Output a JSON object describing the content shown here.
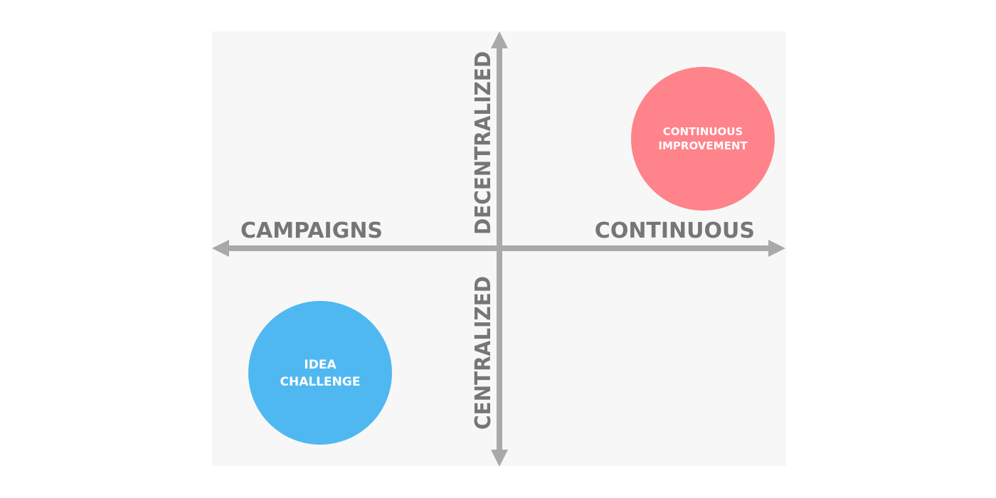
{
  "diagram": {
    "type": "quadrant",
    "axes": {
      "horizontal": {
        "left_label": "CAMPAIGNS",
        "right_label": "CONTINUOUS"
      },
      "vertical": {
        "top_label": "DECENTRALIZED",
        "bottom_label": "CENTRALIZED"
      }
    },
    "bubbles": [
      {
        "id": "continuous-improvement",
        "lines": [
          "CONTINUOUS",
          "IMPROVEMENT"
        ],
        "quadrant": "top-right",
        "color": "#ff838a"
      },
      {
        "id": "idea-challenge",
        "lines": [
          "IDEA",
          "CHALLENGE"
        ],
        "quadrant": "bottom-left",
        "color": "#4fb8f1"
      }
    ],
    "colors": {
      "background": "#f7f7f7",
      "axis": "#a9a9a9",
      "axis_label": "#767676",
      "bubble_text": "#ffffff"
    }
  }
}
